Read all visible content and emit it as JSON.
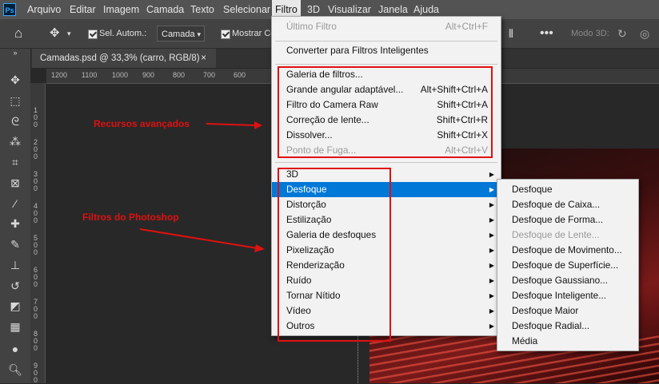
{
  "menubar": {
    "logo": "Ps",
    "items": [
      "Arquivo",
      "Editar",
      "Imagem",
      "Camada",
      "Texto",
      "Selecionar",
      "Filtro",
      "3D",
      "Visualizar",
      "Janela",
      "Ajuda"
    ]
  },
  "options_bar": {
    "auto_select_label": "Sel. Autom.:",
    "layer_select_value": "Camada",
    "show_transform_label": "Mostrar Co",
    "mode_3d_label": "Modo 3D:"
  },
  "document_tab": {
    "title": "Camadas.psd @ 33,3% (carro, RGB/8)",
    "close": "×"
  },
  "ruler": {
    "h_labels": [
      "1200",
      "1100",
      "1000",
      "900",
      "800",
      "700",
      "600"
    ],
    "v_labels": [
      "1\n0\n0",
      "2\n0\n0",
      "3\n0\n0",
      "4\n0\n0",
      "5\n0\n0",
      "6\n0\n0",
      "7\n0\n0",
      "8\n0\n0",
      "9\n0\n0"
    ]
  },
  "filter_menu": {
    "top": [
      {
        "label": "Último Filtro",
        "shortcut": "Alt+Ctrl+F",
        "disabled": true
      }
    ],
    "convert": {
      "label": "Converter para Filtros Inteligentes"
    },
    "advanced": [
      {
        "label": "Galeria de filtros...",
        "shortcut": "",
        "disabled": false
      },
      {
        "label": "Grande angular adaptável...",
        "shortcut": "Alt+Shift+Ctrl+A",
        "disabled": false
      },
      {
        "label": "Filtro do Camera Raw",
        "shortcut": "Shift+Ctrl+A",
        "disabled": false
      },
      {
        "label": "Correção de lente...",
        "shortcut": "Shift+Ctrl+R",
        "disabled": false
      },
      {
        "label": "Dissolver...",
        "shortcut": "Shift+Ctrl+X",
        "disabled": false
      },
      {
        "label": "Ponto de Fuga...",
        "shortcut": "Alt+Ctrl+V",
        "disabled": true
      }
    ],
    "submenus": [
      "3D",
      "Desfoque",
      "Distorção",
      "Estilização",
      "Galeria de desfoques",
      "Pixelização",
      "Renderização",
      "Ruído",
      "Tornar Nítido",
      "Vídeo",
      "Outros"
    ],
    "highlighted": "Desfoque"
  },
  "blur_submenu": [
    {
      "label": "Desfoque",
      "disabled": false
    },
    {
      "label": "Desfoque de Caixa...",
      "disabled": false
    },
    {
      "label": "Desfoque de Forma...",
      "disabled": false
    },
    {
      "label": "Desfoque de Lente...",
      "disabled": true
    },
    {
      "label": "Desfoque de Movimento...",
      "disabled": false
    },
    {
      "label": "Desfoque de Superfície...",
      "disabled": false
    },
    {
      "label": "Desfoque Gaussiano...",
      "disabled": false
    },
    {
      "label": "Desfoque Inteligente...",
      "disabled": false
    },
    {
      "label": "Desfoque Maior",
      "disabled": false
    },
    {
      "label": "Desfoque Radial...",
      "disabled": false
    },
    {
      "label": "Média",
      "disabled": false
    }
  ],
  "annotations": {
    "advanced": "Recursos avançados",
    "filters": "Filtros do Photoshop"
  },
  "colors": {
    "annotation_red": "#e01010",
    "highlight_blue": "#0078d7"
  }
}
